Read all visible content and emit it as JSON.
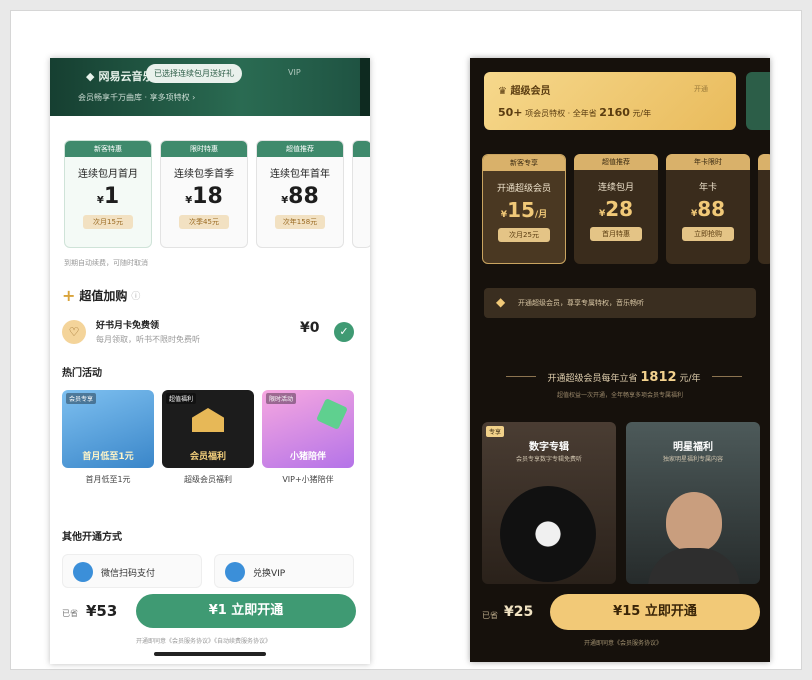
{
  "left": {
    "header": {
      "brand": "网易云音乐",
      "pill": "已选择连续包月送好礼",
      "subtitle": "会员畅享千万曲库 · 享多项特权 ›",
      "tag": "VIP"
    },
    "plans": [
      {
        "badge": "新客特惠",
        "name": "连续包月首月",
        "price": "1",
        "tag": "次月15元"
      },
      {
        "badge": "限时特惠",
        "name": "连续包季首季",
        "price": "18",
        "tag": "次季45元"
      },
      {
        "badge": "超值推荐",
        "name": "连续包年首年",
        "price": "88",
        "tag": "次年158元"
      }
    ],
    "plan_note": "到期自动续费，可随时取消",
    "addon": {
      "title": "超值加购",
      "item_title": "好书月卡免费领",
      "item_sub": "每月领取，听书不限时免费听",
      "price": "¥0"
    },
    "hot_title": "热门活动",
    "activities": [
      {
        "badge": "会员专享",
        "text": "首月低至1元",
        "label": "首月低至1元"
      },
      {
        "badge": "超值福利",
        "text": "会员福利",
        "label": "超级会员福利"
      },
      {
        "badge": "限时活动",
        "text": "小猪陪伴",
        "label": "VIP+小猪陪伴"
      }
    ],
    "pay_title": "其他开通方式",
    "pay_methods": [
      {
        "label": "微信扫码支付"
      },
      {
        "label": "兑换VIP"
      }
    ],
    "bottom": {
      "was_label": "已省",
      "total": "¥53",
      "button": "¥1 立即开通",
      "agreement": "开通即同意《会员服务协议》《自动续费服务协议》"
    }
  },
  "right": {
    "card": {
      "name": "超级会员",
      "tag": "开通",
      "stat_prefix": "50+",
      "stat_mid": "项会员特权 · 全年省",
      "stat_value": "2160",
      "stat_suffix": "元/年"
    },
    "plans": [
      {
        "badge": "新客专享",
        "name": "开通超级会员",
        "price": "15",
        "unit": "/月",
        "tag": "次月25元"
      },
      {
        "badge": "超值推荐",
        "name": "连续包月",
        "price": "28",
        "unit": "",
        "tag": "首月特惠"
      },
      {
        "badge": "年卡限时",
        "name": "年卡",
        "price": "88",
        "unit": "",
        "tag": "立即抢购"
      }
    ],
    "notice": "开通超级会员，尊享专属特权，音乐畅听",
    "divider_prefix": "开通超级会员每年立省",
    "divider_value": "1812",
    "divider_suffix": "元/年",
    "divider_sub": "超值权益一次开通，全年畅享多项会员专属福利",
    "benefits": [
      {
        "badge": "专享",
        "title": "数字专辑",
        "sub": "会员专享数字专辑免费听"
      },
      {
        "badge": "",
        "title": "明星福利",
        "sub": "独家明星福利专属内容"
      }
    ],
    "bottom": {
      "was_label": "已省",
      "total": "¥25",
      "button": "¥15 立即开通",
      "agreement": "开通即同意《会员服务协议》"
    }
  },
  "colors": {
    "left_accent": "#3f9a73",
    "right_accent": "#f2c977"
  }
}
